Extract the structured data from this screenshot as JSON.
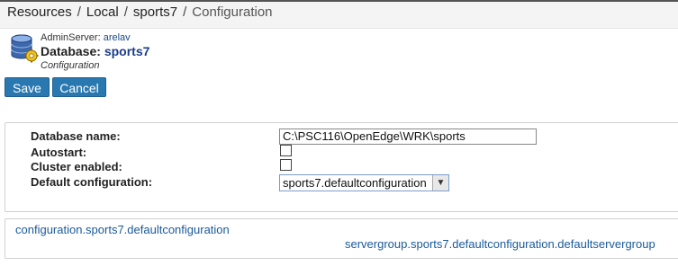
{
  "breadcrumb": {
    "items": [
      "Resources",
      "Local",
      "sports7",
      "Configuration"
    ],
    "separator": "/"
  },
  "header": {
    "admin_label": "AdminServer:",
    "admin_value": "arelav",
    "db_label": "Database:",
    "db_value": "sports7",
    "subtitle": "Configuration"
  },
  "buttons": {
    "save": "Save",
    "cancel": "Cancel"
  },
  "form": {
    "database_name_label": "Database name:",
    "database_name_value": "C:\\PSC116\\OpenEdge\\WRK\\sports",
    "autostart_label": "Autostart:",
    "autostart_checked": false,
    "cluster_label": "Cluster enabled:",
    "cluster_checked": false,
    "default_config_label": "Default configuration:",
    "default_config_value": "sports7.defaultconfiguration"
  },
  "links": {
    "configuration": "configuration.sports7.defaultconfiguration",
    "servergroup": "servergroup.sports7.defaultconfiguration.defaultservergroup"
  },
  "colors": {
    "button_bg": "#2a78b0",
    "link": "#1a5a9a"
  }
}
